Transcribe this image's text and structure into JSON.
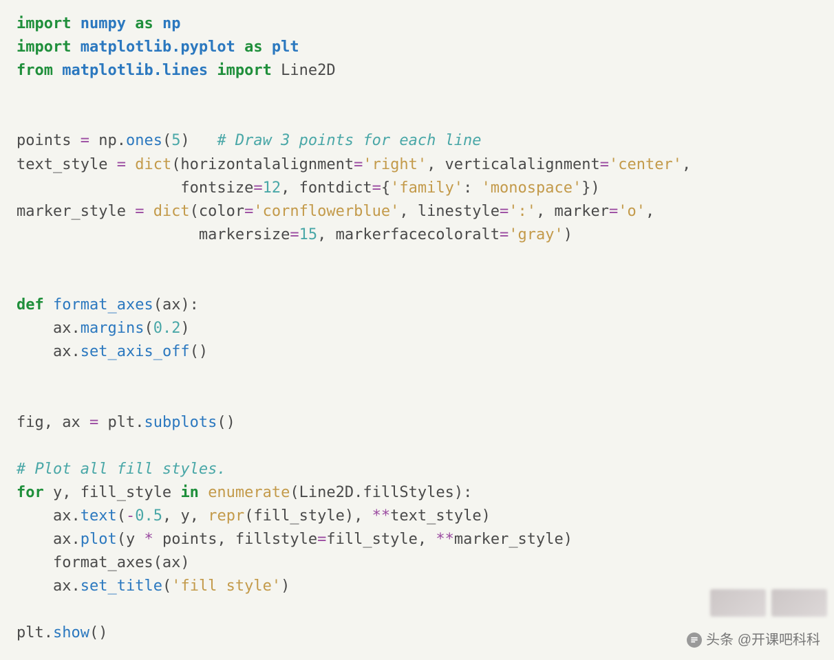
{
  "code": {
    "l1": {
      "kw1": "import",
      "mod": "numpy",
      "kw2": "as",
      "alias": "np"
    },
    "l2": {
      "kw1": "import",
      "mod": "matplotlib.pyplot",
      "kw2": "as",
      "alias": "plt"
    },
    "l3": {
      "kw1": "from",
      "mod": "matplotlib.lines",
      "kw2": "import",
      "name": "Line2D"
    },
    "l5": {
      "a": "points ",
      "op": "=",
      "b": " np",
      "dot": ".",
      "fn": "ones",
      "p": "(",
      "n": "5",
      "q": ")   ",
      "cmt": "# Draw 3 points for each line"
    },
    "l6": {
      "a": "text_style ",
      "op": "=",
      "sp": " ",
      "bui": "dict",
      "p": "(horizontalalignment",
      "eq": "=",
      "s1": "'right'",
      "c1": ", verticalalignment",
      "eq2": "=",
      "s2": "'center'",
      "c2": ","
    },
    "l7": {
      "pad": "                  ",
      "a": "fontsize",
      "op": "=",
      "n": "12",
      "c": ", fontdict",
      "op2": "=",
      "br": "{",
      "s1": "'family'",
      "col": ": ",
      "s2": "'monospace'",
      "cl": "})"
    },
    "l8": {
      "a": "marker_style ",
      "op": "=",
      "sp": " ",
      "bui": "dict",
      "p": "(color",
      "eq": "=",
      "s1": "'cornflowerblue'",
      "c1": ", linestyle",
      "eq2": "=",
      "s2": "':'",
      "c2": ", marker",
      "eq3": "=",
      "s3": "'o'",
      "c3": ","
    },
    "l9": {
      "pad": "                    ",
      "a": "markersize",
      "op": "=",
      "n": "15",
      "c": ", markerfacecoloralt",
      "op2": "=",
      "s": "'gray'",
      "cl": ")"
    },
    "l11": {
      "kw": "def",
      "sp": " ",
      "fn": "format_axes",
      "p": "(ax):"
    },
    "l12": {
      "pad": "    ",
      "a": "ax",
      "dot": ".",
      "fn": "margins",
      "p": "(",
      "n": "0.2",
      "q": ")"
    },
    "l13": {
      "pad": "    ",
      "a": "ax",
      "dot": ".",
      "fn": "set_axis_off",
      "p": "()"
    },
    "l15": {
      "a": "fig, ax ",
      "op": "=",
      "b": " plt",
      "dot": ".",
      "fn": "subplots",
      "p": "()"
    },
    "l17": {
      "cmt": "# Plot all fill styles."
    },
    "l18": {
      "kw1": "for",
      "a": " y, fill_style ",
      "kw2": "in",
      "sp": " ",
      "bui": "enumerate",
      "p": "(Line2D",
      "dot": ".",
      "attr": "fillStyles",
      "q": "):"
    },
    "l19": {
      "pad": "    ",
      "a": "ax",
      "dot": ".",
      "fn": "text",
      "p": "(",
      "op": "-",
      "n1": "0.5",
      "c1": ", y, ",
      "bui": "repr",
      "p2": "(fill_style), ",
      "st": "**",
      "t": "text_style)"
    },
    "l20": {
      "pad": "    ",
      "a": "ax",
      "dot": ".",
      "fn": "plot",
      "p": "(y ",
      "op": "*",
      "b": " points, fillstyle",
      "eq": "=",
      "c": "fill_style, ",
      "st": "**",
      "t": "marker_style)"
    },
    "l21": {
      "pad": "    ",
      "a": "format_axes(ax)"
    },
    "l22": {
      "pad": "    ",
      "a": "ax",
      "dot": ".",
      "fn": "set_title",
      "p": "(",
      "s": "'fill style'",
      "q": ")"
    },
    "l24": {
      "a": "plt",
      "dot": ".",
      "fn": "show",
      "p": "()"
    }
  },
  "watermark": {
    "label": "头条 @开课吧科科"
  }
}
